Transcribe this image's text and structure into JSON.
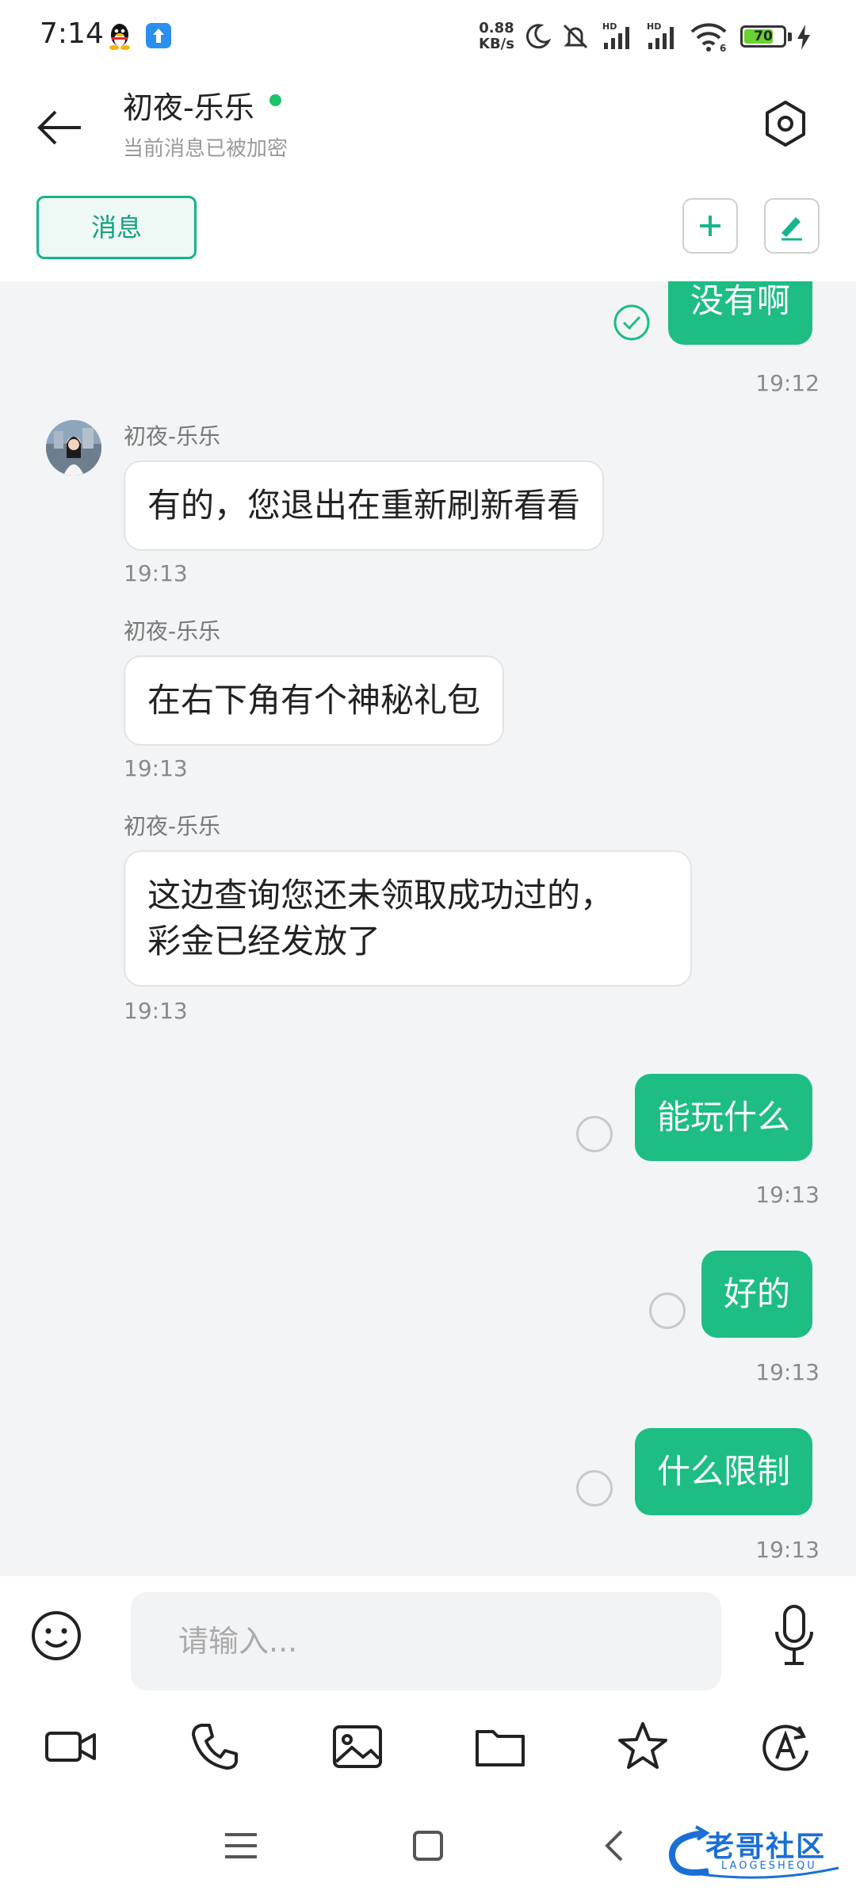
{
  "status_bar": {
    "time": "7:14",
    "net_speed_value": "0.88",
    "net_speed_unit": "KB/s",
    "battery": "70",
    "battery_level": 0.7,
    "icons": [
      "qq-icon",
      "upload-app-icon",
      "moon-icon",
      "mute-icon",
      "signal-hd-icon",
      "signal-hd-icon",
      "wifi-icon",
      "battery-icon",
      "charging-icon"
    ]
  },
  "header": {
    "contact_name": "初夜-乐乐",
    "online_color": "#19c46b",
    "encrypt_note": "当前消息已被加密",
    "tab_label": "消息"
  },
  "messages": [
    {
      "dir": "out",
      "text": "没有啊",
      "status": "read",
      "time": "19:12"
    },
    {
      "dir": "in",
      "sender": "初夜-乐乐",
      "text": "有的，您退出在重新刷新看看",
      "time": "19:13"
    },
    {
      "dir": "in",
      "sender": "初夜-乐乐",
      "text": "在右下角有个神秘礼包",
      "time": "19:13"
    },
    {
      "dir": "in",
      "sender": "初夜-乐乐",
      "line1": "这边查询您还未领取成功过的，",
      "line2": "彩金已经发放了",
      "time": "19:13"
    },
    {
      "dir": "out",
      "text": "能玩什么",
      "status": "sent",
      "time": "19:13"
    },
    {
      "dir": "out",
      "text": "好的",
      "status": "sent",
      "time": "19:13"
    },
    {
      "dir": "out",
      "text": "什么限制",
      "status": "sent",
      "time": "19:13"
    }
  ],
  "input": {
    "placeholder": "请输入...",
    "value": ""
  },
  "toolbar": [
    "video-call-icon",
    "phone-call-icon",
    "image-icon",
    "folder-icon",
    "star-icon",
    "translate-icon"
  ],
  "watermark": {
    "text": "老哥社区",
    "sub": "LAOGESHEQU"
  },
  "colors": {
    "accent": "#1dbd84",
    "chat_bg": "#f3f4f6"
  }
}
